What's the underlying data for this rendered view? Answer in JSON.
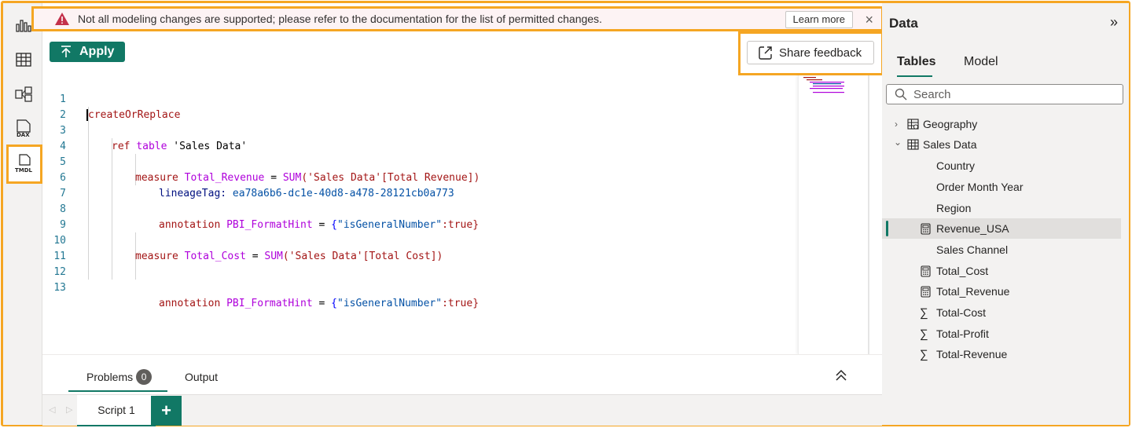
{
  "warning": {
    "message": "Not all modeling changes are supported; please refer to the documentation for the list of permitted changes.",
    "learn_more_label": "Learn more",
    "close_glyph": "×"
  },
  "left_rail": {
    "items": [
      {
        "name": "report-view",
        "icon": "bar-chart-icon"
      },
      {
        "name": "table-view",
        "icon": "table-grid-icon"
      },
      {
        "name": "model-view",
        "icon": "model-diagram-icon"
      },
      {
        "name": "dax-query-view",
        "icon": "dax-icon",
        "label": "DAX"
      },
      {
        "name": "tmdl-view",
        "icon": "tmdl-icon",
        "label": "TMDL",
        "active": true
      }
    ]
  },
  "toolbar": {
    "apply_label": "Apply",
    "share_feedback_label": "Share feedback"
  },
  "editor": {
    "line_numbers": [
      "1",
      "2",
      "3",
      "4",
      "5",
      "6",
      "7",
      "8",
      "9",
      "10",
      "11",
      "12",
      "13"
    ],
    "lines": {
      "l1": "createOrReplace",
      "l3_kw1": "ref",
      "l3_kw2": "table",
      "l3_name": "'Sales Data'",
      "l5_kw": "measure",
      "l5_name": "Total_Revenue",
      "l5_eq": " = ",
      "l5_fn": "SUM",
      "l5_arg": "('Sales Data'[Total Revenue])",
      "l6_key": "lineageTag:",
      "l6_val": "ea78a6b6-dc1e-40d8-a478-28121cb0a773",
      "l8_kw": "annotation",
      "l8_name": "PBI_FormatHint",
      "l8_eq": " = ",
      "l8_val_open": "{",
      "l8_str": "\"isGeneralNumber\"",
      "l8_rest": ":true}",
      "l10_kw": "measure",
      "l10_name": "Total_Cost",
      "l10_eq": " = ",
      "l10_fn": "SUM",
      "l10_arg": "('Sales Data'[Total Cost])",
      "l13_kw": "annotation",
      "l13_name": "PBI_FormatHint",
      "l13_eq": " = ",
      "l13_val_open": "{",
      "l13_str": "\"isGeneralNumber\"",
      "l13_rest": ":true}"
    }
  },
  "bottom_panel": {
    "problems_label": "Problems",
    "problems_count": "0",
    "output_label": "Output",
    "script_tab_label": "Script 1",
    "add_label": "+"
  },
  "data_pane": {
    "title": "Data",
    "tabs": [
      "Tables",
      "Model"
    ],
    "search_placeholder": "Search",
    "tree": [
      {
        "label": "Geography",
        "type": "table",
        "expanded": false
      },
      {
        "label": "Sales Data",
        "type": "table",
        "expanded": true
      },
      {
        "label": "Country",
        "type": "column"
      },
      {
        "label": "Order Month Year",
        "type": "column"
      },
      {
        "label": "Region",
        "type": "column"
      },
      {
        "label": "Revenue_USA",
        "type": "measure",
        "selected": true
      },
      {
        "label": "Sales Channel",
        "type": "column"
      },
      {
        "label": "Total_Cost",
        "type": "measure"
      },
      {
        "label": "Total_Revenue",
        "type": "measure"
      },
      {
        "label": "Total-Cost",
        "type": "sum-column"
      },
      {
        "label": "Total-Profit",
        "type": "sum-column"
      },
      {
        "label": "Total-Revenue",
        "type": "sum-column"
      }
    ]
  },
  "colors": {
    "accent_green": "#117865",
    "highlight_orange": "#f5a623",
    "warning_red": "#c4314b"
  }
}
